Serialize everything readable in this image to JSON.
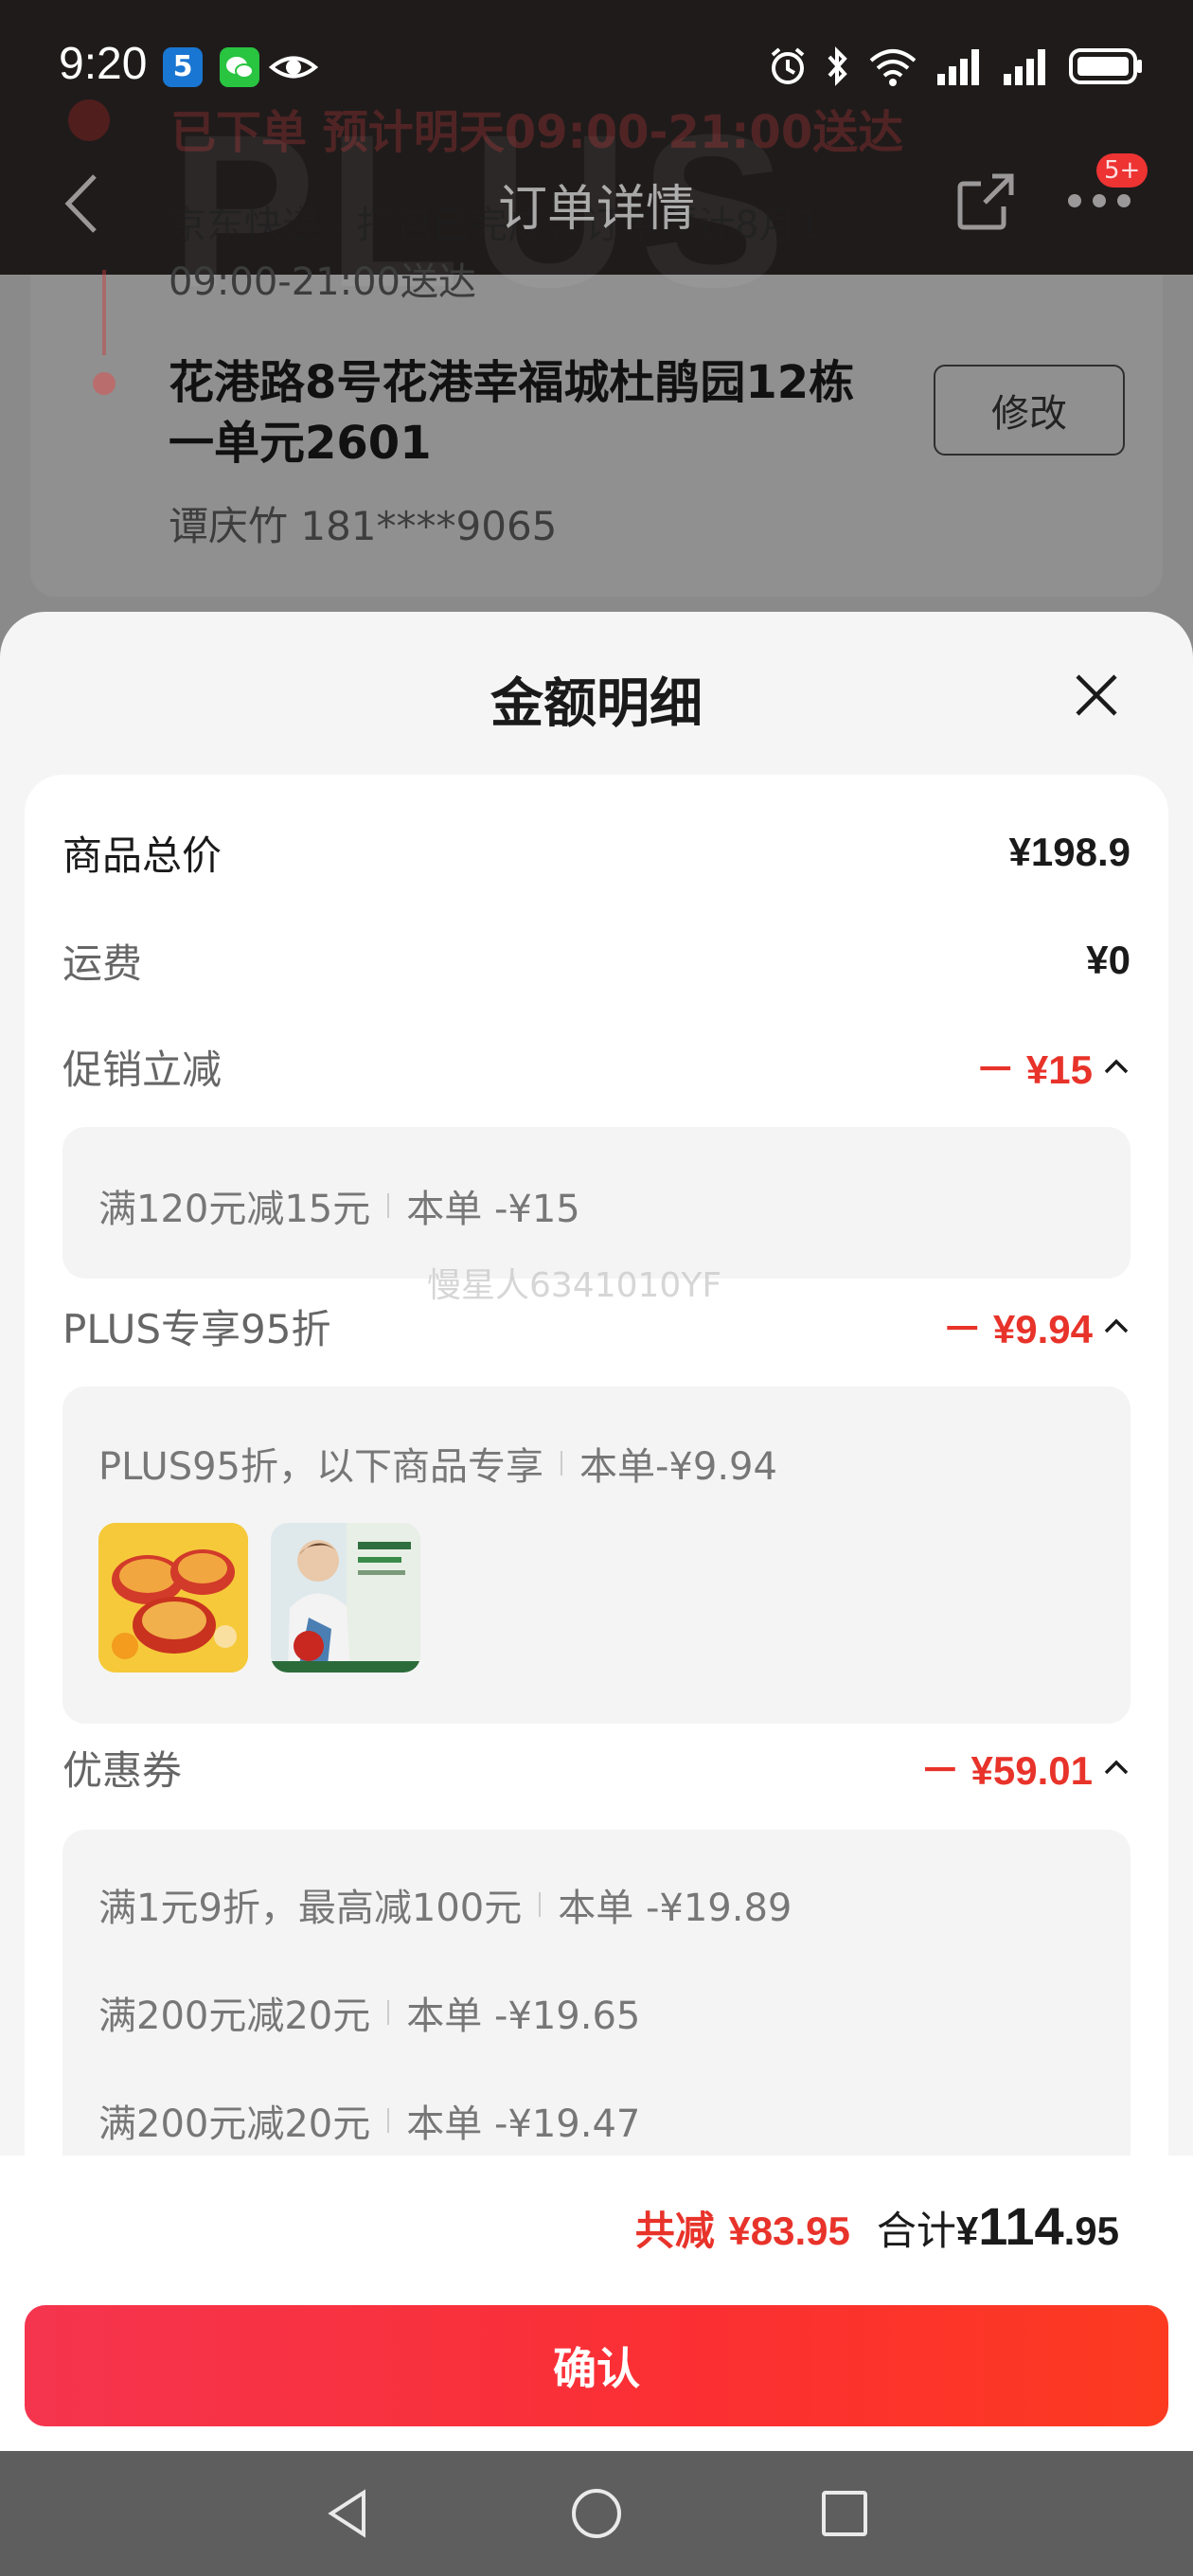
{
  "status_bar": {
    "time": "9:20",
    "icons": [
      "app-5-icon",
      "wechat-icon",
      "eye-icon",
      "alarm-icon",
      "bluetooth-icon",
      "wifi-icon",
      "signal-icon",
      "signal-icon",
      "battery-icon"
    ],
    "app_5_glyph": "5"
  },
  "background_page": {
    "header_title": "订单详情",
    "badge": "5+",
    "delivery_status": "已下单  预计明天09:00-21:00送达",
    "delivery_sub_1": "京东快递 · 打包已完成，订单预计8月1",
    "delivery_sub_2": "09:00-21:00送达",
    "address": "花港路8号花港幸福城杜鹃园12栋一单元2601",
    "contact": "谭庆竹 181****9065",
    "modify_label": "修改",
    "watermark_text": "PLUS"
  },
  "sheet": {
    "title": "金额明细",
    "rows": {
      "goods_total": {
        "label": "商品总价",
        "amount": "¥198.9"
      },
      "shipping": {
        "label": "运费",
        "amount": "¥0"
      },
      "promo": {
        "label": "促销立减",
        "amount": "－ ¥15"
      },
      "plus": {
        "label": "PLUS专享95折",
        "amount": "－ ¥9.94"
      },
      "coupon": {
        "label": "优惠券",
        "amount": "－ ¥59.01"
      }
    },
    "promo_detail": {
      "rule": "满120元减15元",
      "value": "本单 -¥15"
    },
    "plus_detail": {
      "rule": "PLUS95折，以下商品专享",
      "value": "本单-¥9.94"
    },
    "coupon_details": [
      {
        "rule": "满1元9折，最高减100元",
        "value": "本单 -¥19.89"
      },
      {
        "rule": "满200元减20元",
        "value": "本单 -¥19.65"
      },
      {
        "rule": "满200元减20元",
        "value": "本单 -¥19.47"
      }
    ],
    "watermark": "慢星人6341010YF"
  },
  "footer": {
    "saved_label": "共减",
    "saved_value": "¥83.95",
    "total_label": "合计",
    "total_currency": "¥",
    "total_int": "114",
    "total_dec": ".95",
    "confirm_label": "确认"
  },
  "colors": {
    "accent_red": "#e8332a",
    "button_gradient_start": "#f5344e",
    "button_gradient_end": "#fc3a20"
  }
}
